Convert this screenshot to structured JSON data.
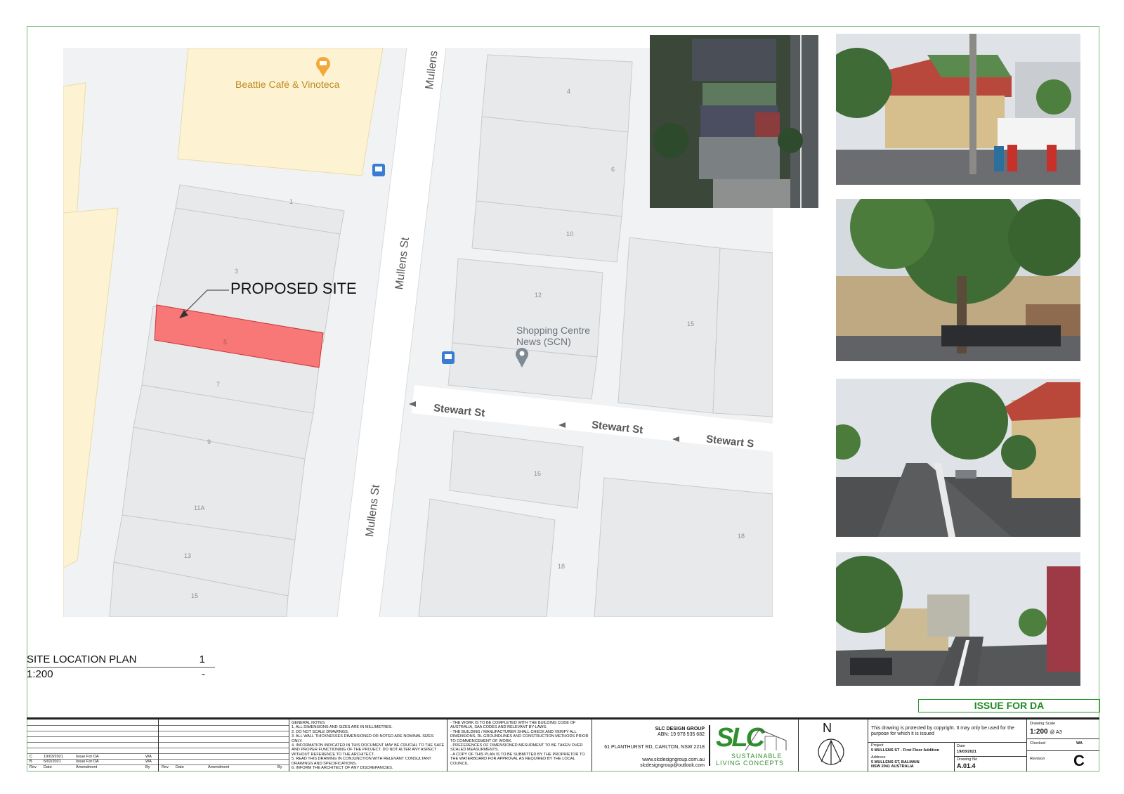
{
  "map": {
    "poi_cafe": "Beattie Café & Vinoteca",
    "poi_news_line1": "Shopping Centre",
    "poi_news_line2": "News (SCN)",
    "street_mullens": "Mullens St",
    "street_stewart": "Stewart St",
    "street_stewart_cut": "Stewart S",
    "proposed_site": "PROPOSED SITE",
    "lot_numbers": [
      "1",
      "3",
      "5",
      "7",
      "9",
      "11A",
      "13",
      "15",
      "4",
      "6",
      "10",
      "12",
      "15",
      "16",
      "18",
      "18"
    ],
    "colors": {
      "site_fill": "#f87777",
      "cafe_block": "#fdf3d2",
      "bus_icon": "#3a7bd5",
      "poi_pin": "#f2a93b"
    }
  },
  "plan": {
    "title": "SITE LOCATION PLAN",
    "number": "1",
    "scale": "1:200",
    "dash": "-"
  },
  "issue_label": "ISSUE FOR DA",
  "title_block": {
    "revisions": [
      {
        "rev": "C",
        "date": "19/03/2021",
        "amendment": "Issue For DA",
        "by": "WA"
      },
      {
        "rev": "B",
        "date": "5/02/2021",
        "amendment": "Issue For DA",
        "by": "WA"
      }
    ],
    "rev_headers": {
      "rev": "Rev",
      "date": "Date",
      "amendment": "Amendment",
      "by": "By"
    },
    "general_notes_title": "GENERAL NOTES",
    "general_notes": [
      "1. ALL DIMENSIONS AND SIZES ARE IN MILLIMETRES.",
      "2. DO NOT SCALE DRAWINGS.",
      "3. ALL WALL THICKNESSES DIMENSIONED OR NOTED ARE NOMINAL SIZES ONLY.",
      "4. INFORMATION INDICATED IN THIS DOCUMENT MAY BE CRUCIAL TO THE SAFE AND PROPER FUNCTIONING OF THE PROJECT. DO NOT ALTER ANY ASPECT WITHOUT REFERENCE TO THE ARCHITECT.",
      "5. READ THIS DRAWING IN CONJUNCTION WITH RELEVANT CONSULTANT DRAWINGS AND SPECIFICATIONS.",
      "6. INFORM THE ARCHITECT OF ANY DISCREPANCIES."
    ],
    "notes_b": [
      "- THE WORK IS TO BE COMPLETED WITH THE BUILDING CODE OF AUSTRALIA, SAA CODES AND RELEVANT BY-LAWS.",
      "- THE BUILDING / MANUFACTURER SHALL CHECK AND VERIFY ALL DIMENSIONS, RL GROUNDLINES AND CONSTRUCTION METHODS PRIOR TO COMMENCEMENT OF WORK.",
      "- PREFERENCES OF DIMENSIONED MESURMENT TO BE TAKEN OVER SCALED MEASURMENTS.",
      "- A COPY OF THIS PLAN IS TO BE SUBMITTED BY THE PROPRIETOR TO THE WATERBOARD FOR APPROVAL AS REQUIRED BY THE LOCAL COUNCIL."
    ],
    "company": "SLC DESIGN GROUP",
    "abn": "ABN: 19 978 535 682",
    "address": "61 PLANTHURST RD, CARLTON, NSW 2218",
    "web": "www.slcdesigngroup.com.au",
    "email": "slcdesigngroup@outlook.com",
    "logo_letters": "SLC",
    "logo_line1": "SUSTAINABLE",
    "logo_line2": "LIVING CONCEPTS",
    "north": "N",
    "copyright": "This drawing is protected by copyright. It may only be used for the purpose for which it is issued",
    "project_label": "Project",
    "project": "5 MULLENS ST - First Floor Addition",
    "address_label": "Address",
    "site_address1": "5 MULLENS ST, BALMAIN",
    "site_address2": "NSW 2041 AUSTRALIA",
    "date_label": "Date",
    "date": "19/03/2021",
    "drawing_no_label": "Drawing No",
    "drawing_no": "A.01.4",
    "scale_label": "Drawing Scale",
    "scale": "1:200",
    "scale_suffix": "@ A3",
    "checked_label": "Checked",
    "checked": "WA",
    "revision_label": "Revision",
    "revision": "C"
  }
}
